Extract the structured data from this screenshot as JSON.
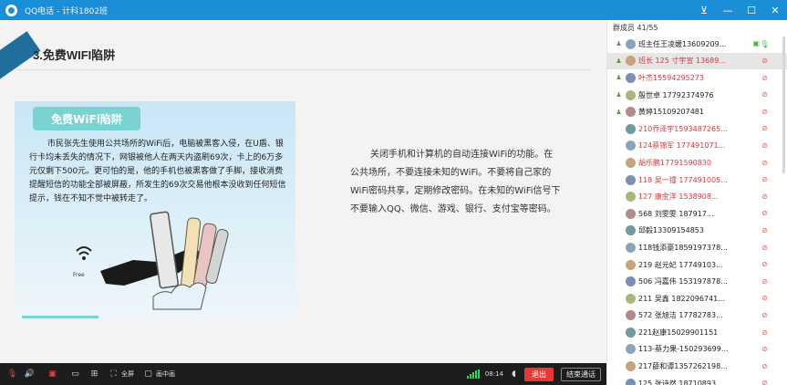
{
  "window": {
    "title": "QQ电话 - 计科1802班"
  },
  "slide": {
    "badge": "",
    "heading": "3.免费WIFI陷阱",
    "card_tag": "免费WiFi陷阱",
    "card_text": "市民张先生使用公共场所的WiFi后，电脑被黑客入侵，在U盾、银行卡均未丢失的情况下，网银被他人在两天内盗刷69次，卡上的6万多元仅剩下500元。更可怕的是，他的手机也被黑客做了手脚，接收消费提醒短信的功能全部被屏蔽，所发生的69次交易他根本没收到任何短信提示，钱在不知不觉中被转走了。",
    "illus_label": "Free",
    "body_text": "关闭手机和计算机的自动连接WiFi的功能。在公共场所，不要连接未知的WiFi。不要将自己家的WiFi密码共享，定期修改密码。在未知的WiFi信号下不要输入QQ、微信、游戏、银行、支付宝等密码。"
  },
  "bottombar": {
    "fullscreen_label": "全屏",
    "pip_label": "画中画",
    "duration": "08:14",
    "exit_label": "退出",
    "end_label": "结束通话",
    "signal_color": "#3ecc5e"
  },
  "members": {
    "header": "群成员 41/55",
    "items": [
      {
        "name": "班主任王凌媛13609209...",
        "color": "normal",
        "role": "admin",
        "speaking": true
      },
      {
        "name": "班长 125 寸宇宣 13689...",
        "color": "red",
        "role": "admin",
        "speaking": false
      },
      {
        "name": "叶杰15594295273",
        "color": "red",
        "role": "admin",
        "speaking": false
      },
      {
        "name": "殷世卓 17792374976",
        "color": "normal",
        "role": "admin",
        "speaking": false
      },
      {
        "name": "黄婷15109207481",
        "color": "normal",
        "role": "admin",
        "speaking": false
      },
      {
        "name": "210乔泽宇1593487265...",
        "color": "red",
        "role": "",
        "speaking": false
      },
      {
        "name": "124蔡锦军 177491071...",
        "color": "red",
        "role": "",
        "speaking": false
      },
      {
        "name": "胡乐鹏17791590830",
        "color": "red",
        "role": "",
        "speaking": false
      },
      {
        "name": "118 吴一镭 177491005...",
        "color": "red",
        "role": "",
        "speaking": false
      },
      {
        "name": "127    康金洋  1538908...",
        "color": "red",
        "role": "",
        "speaking": false
      },
      {
        "name": "568   刘雯雯     187917...",
        "color": "normal",
        "role": "",
        "speaking": false
      },
      {
        "name": "邱毅13309154853",
        "color": "normal",
        "role": "",
        "speaking": false
      },
      {
        "name": "118钱添豪1859197378...",
        "color": "normal",
        "role": "",
        "speaking": false
      },
      {
        "name": "219   赵元妃  17749103...",
        "color": "normal",
        "role": "",
        "speaking": false
      },
      {
        "name": "506 冯嘉伟 153197878...",
        "color": "normal",
        "role": "",
        "speaking": false
      },
      {
        "name": "211  吴鑫  1822096741...",
        "color": "normal",
        "role": "",
        "speaking": false
      },
      {
        "name": "572  张旭洁  17782783...",
        "color": "normal",
        "role": "",
        "speaking": false
      },
      {
        "name": "221赵康15029901151",
        "color": "normal",
        "role": "",
        "speaking": false
      },
      {
        "name": "113-蔡力果-150293699...",
        "color": "normal",
        "role": "",
        "speaking": false
      },
      {
        "name": "217薛和谭1357262198...",
        "color": "normal",
        "role": "",
        "speaking": false
      },
      {
        "name": "125  张诗然  18710893...",
        "color": "normal",
        "role": "",
        "speaking": false
      }
    ]
  }
}
